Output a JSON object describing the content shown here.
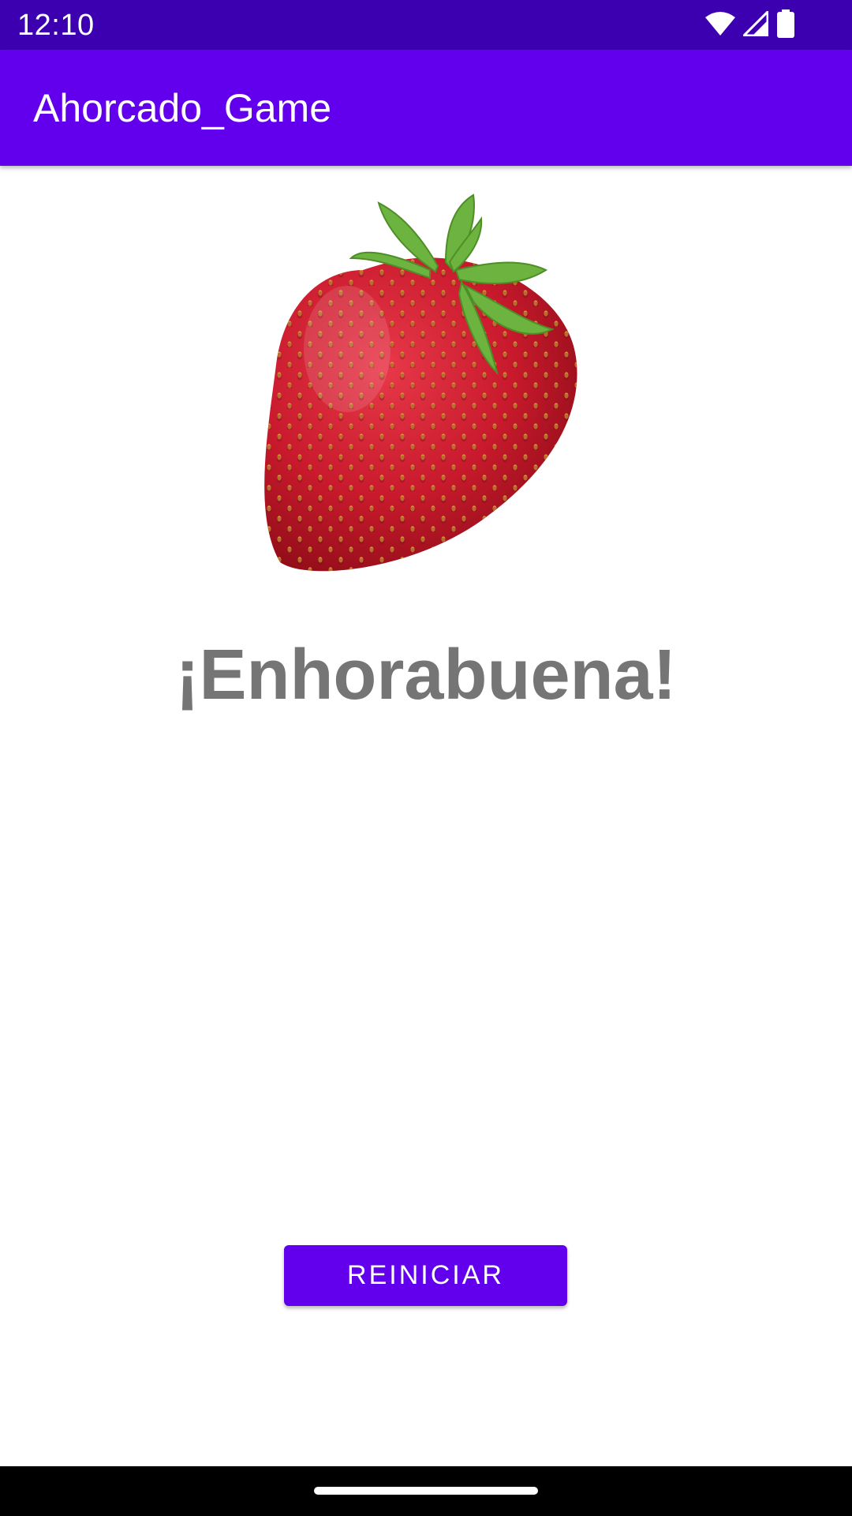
{
  "status_bar": {
    "time": "12:10",
    "icons": [
      "wifi-icon",
      "cell-signal-icon",
      "battery-icon"
    ],
    "background": "#3c00b1"
  },
  "app_bar": {
    "title": "Ahorcado_Game",
    "background": "#6200ee"
  },
  "main": {
    "image": "strawberry",
    "message": "¡Enhorabuena!",
    "message_color": "#757575",
    "restart_label": "REINICIAR",
    "button_color": "#6200ee"
  }
}
